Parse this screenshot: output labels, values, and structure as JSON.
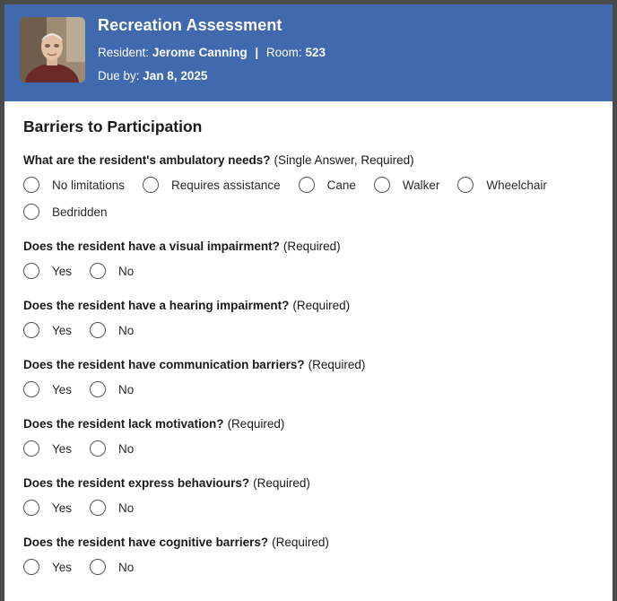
{
  "header": {
    "title": "Recreation Assessment",
    "resident_label": "Resident:",
    "resident_name": "Jerome Canning",
    "separator": "|",
    "room_label": "Room:",
    "room_number": "523",
    "due_label": "Due by:",
    "due_date": "Jan 8, 2025"
  },
  "section": {
    "title": "Barriers to Participation"
  },
  "questions": [
    {
      "text": "What are the resident's ambulatory needs?",
      "qualifier": "(Single Answer, Required)",
      "options": [
        "No limitations",
        "Requires assistance",
        "Cane",
        "Walker",
        "Wheelchair",
        "Bedridden"
      ]
    },
    {
      "text": "Does the resident have a visual impairment?",
      "qualifier": "(Required)",
      "options": [
        "Yes",
        "No"
      ]
    },
    {
      "text": "Does the resident have a hearing impairment?",
      "qualifier": "(Required)",
      "options": [
        "Yes",
        "No"
      ]
    },
    {
      "text": "Does the resident have communication barriers?",
      "qualifier": "(Required)",
      "options": [
        "Yes",
        "No"
      ]
    },
    {
      "text": "Does the resident lack motivation?",
      "qualifier": "(Required)",
      "options": [
        "Yes",
        "No"
      ]
    },
    {
      "text": "Does the resident express behaviours?",
      "qualifier": "(Required)",
      "options": [
        "Yes",
        "No"
      ]
    },
    {
      "text": "Does the resident have cognitive barriers?",
      "qualifier": "(Required)",
      "options": [
        "Yes",
        "No"
      ]
    }
  ],
  "colors": {
    "header_bg": "#4169ae",
    "radio_border": "#555555",
    "window_border": "#4a4a4a"
  },
  "icons": {
    "avatar": "resident-photo"
  }
}
